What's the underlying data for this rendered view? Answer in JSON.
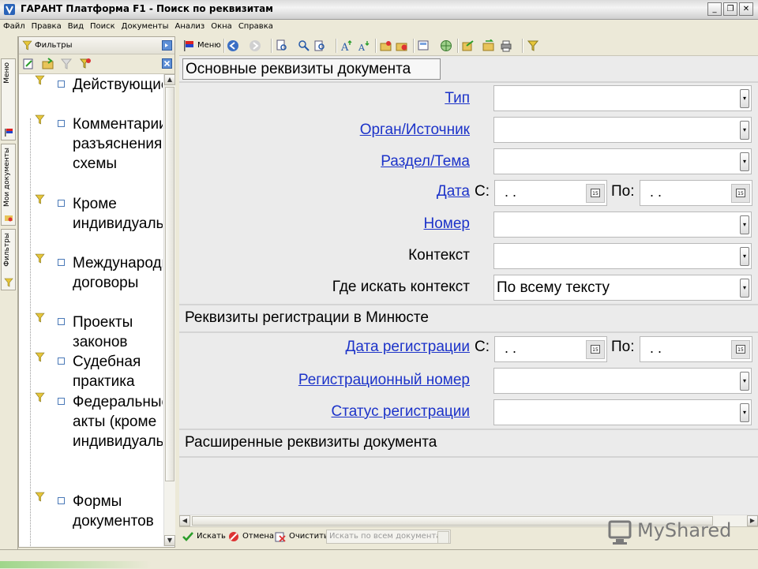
{
  "window": {
    "title": "ГАРАНТ Платформа F1 - Поиск по реквизитам"
  },
  "menubar": [
    "Файл",
    "Правка",
    "Вид",
    "Поиск",
    "Документы",
    "Анализ",
    "Окна",
    "Справка"
  ],
  "side_tabs": [
    "Меню",
    "Мои документы",
    "Фильтры"
  ],
  "left_panel": {
    "title": "Фильтры",
    "items": [
      "Действующие",
      "Комментарии, разъяснения, схемы",
      "Кроме индивидуальных",
      "Международные договоры",
      "Проекты законов",
      "Судебная практика",
      "Федеральные акты (кроме индивидуальных)",
      "Формы документов"
    ]
  },
  "toolbar": {
    "menu_label": "Меню"
  },
  "sections": {
    "main": "Основные реквизиты документа",
    "registration": "Реквизиты регистрации в Минюсте",
    "extended": "Расширенные реквизиты документа"
  },
  "fields": {
    "type": {
      "label": "Тип",
      "value": ""
    },
    "organ": {
      "label": "Орган/Источник",
      "value": ""
    },
    "section": {
      "label": "Раздел/Тема",
      "value": ""
    },
    "date": {
      "label": "Дата",
      "from_label": "С:",
      "to_label": "По:",
      "from_value": ". .",
      "to_value": ". ."
    },
    "number": {
      "label": "Номер",
      "value": ""
    },
    "context": {
      "label": "Контекст",
      "value": ""
    },
    "where": {
      "label": "Где искать контекст",
      "value": "По всему тексту"
    },
    "reg_date": {
      "label": "Дата регистрации",
      "from_label": "С:",
      "to_label": "По:",
      "from_value": ". .",
      "to_value": ". ."
    },
    "reg_number": {
      "label": "Регистрационный номер",
      "value": ""
    },
    "reg_status": {
      "label": "Статус регистрации",
      "value": ""
    }
  },
  "bottom": {
    "search_label": "Искать",
    "cancel_label": "Отмена",
    "clear_label": "Очистить",
    "scope_value": "Искать по всем документам"
  },
  "watermark": "MyShared",
  "colors": {
    "link": "#1c33c9",
    "panel_bg": "#ebebeb",
    "window_bg": "#ece9d8"
  }
}
